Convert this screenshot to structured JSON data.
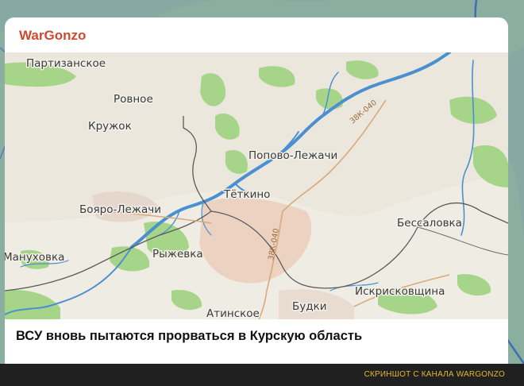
{
  "card": {
    "channel_name": "WarGonzo",
    "headline": "ВСУ вновь пытаются прорваться в Курскую область"
  },
  "map": {
    "places": {
      "partizanskoe": "Партизанское",
      "rovnoe": "Ровное",
      "kruzhok": "Кружок",
      "popovo_lezhachi": "Попово-Лежачи",
      "tyotkino": "Тёткино",
      "boyaro_lezhachi": "Бояро-Лежачи",
      "manukhovka": "Мануховка",
      "ryzhevka": "Рыжевка",
      "bessalovka": "Бессаловка",
      "atinskoe": "Атинское",
      "budki": "Будки",
      "iskriskovshchina": "Искрисковщина"
    },
    "roads": {
      "top": "38К-040",
      "middle": "38К-040"
    }
  },
  "footer": {
    "credit": "СКРИНШОТ С КАНАЛА WARGONZO"
  },
  "colors": {
    "brand": "#d0482f",
    "credit": "#e2b928",
    "map_land": "#f1efe6",
    "forest": "#a6d58a",
    "water": "#4a8fd0",
    "border": "#5a5a5a"
  }
}
